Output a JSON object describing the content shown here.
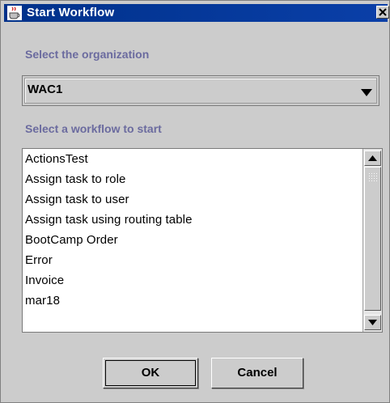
{
  "window": {
    "title": "Start Workflow"
  },
  "form": {
    "org_label": "Select the organization",
    "org_selected": "WAC1",
    "workflow_label": "Select a workflow to start"
  },
  "workflows": [
    "ActionsTest",
    "Assign task to role",
    "Assign task to user",
    "Assign task using routing table",
    "BootCamp Order",
    "Error",
    "Invoice",
    "mar18"
  ],
  "buttons": {
    "ok": "OK",
    "cancel": "Cancel"
  },
  "icons": {
    "title": "java-cup-icon",
    "close": "close-icon",
    "dropdown": "triangle-down-icon",
    "scroll_up": "triangle-up-icon",
    "scroll_down": "triangle-down-icon"
  },
  "colors": {
    "titlebar": "#00318a",
    "label_text": "#6b6b9f",
    "background": "#cccccc"
  }
}
